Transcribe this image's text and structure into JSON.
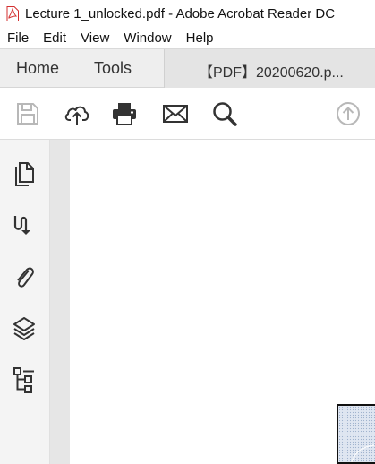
{
  "window": {
    "title": "Lecture 1_unlocked.pdf - Adobe Acrobat Reader DC",
    "app_icon": "pdf-file-icon"
  },
  "menu": [
    "File",
    "Edit",
    "View",
    "Window",
    "Help"
  ],
  "tabs": {
    "home": "Home",
    "tools": "Tools",
    "document": "【PDF】20200620.p..."
  },
  "toolbar": {
    "icons": [
      "save-icon",
      "upload-cloud-icon",
      "print-icon",
      "email-icon",
      "search-icon",
      "scroll-up-icon"
    ]
  },
  "sidebar": {
    "icons": [
      "pages-icon",
      "bookmark-icon",
      "attachment-icon",
      "layers-icon",
      "structure-icon"
    ]
  }
}
